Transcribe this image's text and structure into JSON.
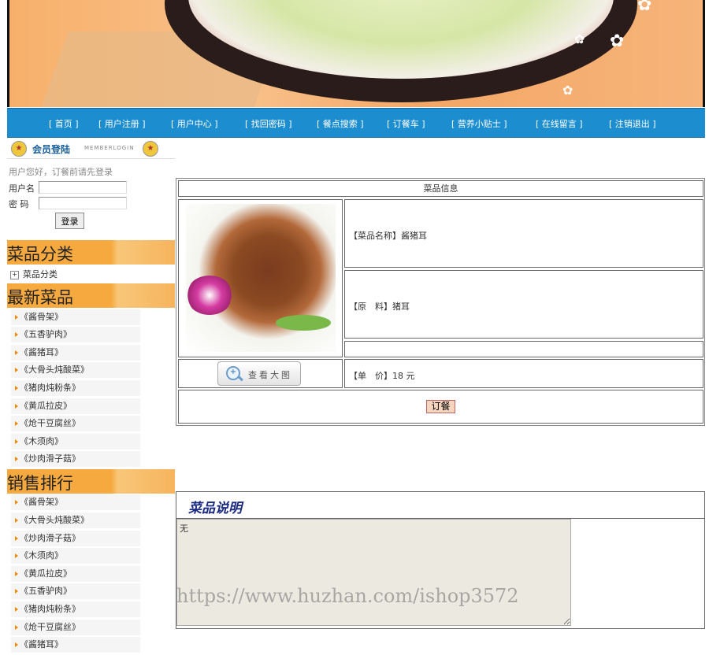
{
  "nav": {
    "items": [
      "[ 首页 ]",
      "[ 用户注册 ]",
      "[ 用户中心 ]",
      "[ 找回密码 ]",
      "[ 餐点搜索 ]",
      "[ 订餐车 ]",
      "[ 营养小贴士 ]",
      "[ 在线留言 ]",
      "[ 注销退出 ]"
    ]
  },
  "login": {
    "title": "会员登陆",
    "subtitle": "MEMBERLOGIN",
    "hint": "用户您好，订餐前请先登录",
    "username_label": "用户名",
    "password_label": "密 码",
    "button": "登录"
  },
  "sections": {
    "category_title": "菜品分类",
    "category_item": "菜品分类",
    "newest_title": "最新菜品",
    "sales_title": "销售排行"
  },
  "newest": [
    "《酱骨架》",
    "《五香驴肉》",
    "《酱猪耳》",
    "《大骨头炖酸菜》",
    "《猪肉炖粉条》",
    "《黄瓜拉皮》",
    "《炝干豆腐丝》",
    "《木须肉》",
    "《炒肉滑子菇》"
  ],
  "sales": [
    "《酱骨架》",
    "《大骨头炖酸菜》",
    "《炒肉滑子菇》",
    "《木须肉》",
    "《黄瓜拉皮》",
    "《五香驴肉》",
    "《猪肉炖粉条》",
    "《炝干豆腐丝》",
    "《酱猪耳》"
  ],
  "dish": {
    "table_title": "菜品信息",
    "name_label": "【菜品名称】",
    "name": "酱猪耳",
    "ingredient_label": "【原　料】",
    "ingredient": "猪耳",
    "price_label": "【单　价】",
    "price": "18 元",
    "zoom_button": "查看大图",
    "order_button": "订餐"
  },
  "description": {
    "title": "菜品说明",
    "text": "无"
  },
  "watermark": "https://www.huzhan.com/ishop3572"
}
